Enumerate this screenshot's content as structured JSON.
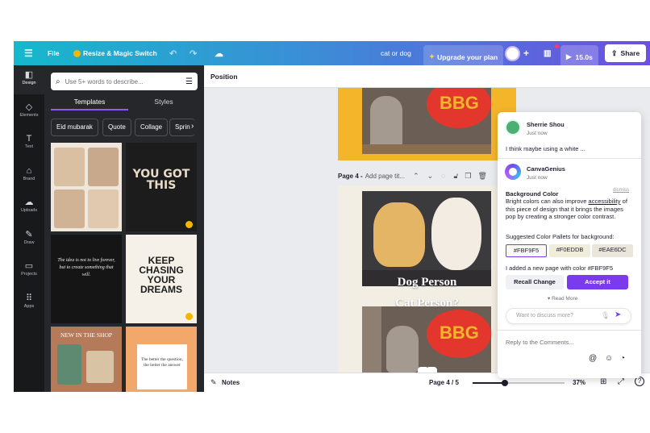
{
  "topbar": {
    "menu_icon": "hamburger-icon",
    "file": "File",
    "resize": "Resize & Magic Switch",
    "design_name": "cat or dog",
    "upgrade": "Upgrade your plan",
    "timer": "15.0s",
    "share": "Share"
  },
  "rail": {
    "items": [
      {
        "label": "Design",
        "icon": "layout-icon"
      },
      {
        "label": "Elements",
        "icon": "shapes-icon"
      },
      {
        "label": "Text",
        "icon": "text-icon"
      },
      {
        "label": "Brand",
        "icon": "brand-icon"
      },
      {
        "label": "Uploads",
        "icon": "cloud-upload-icon"
      },
      {
        "label": "Draw",
        "icon": "pen-icon"
      },
      {
        "label": "Projects",
        "icon": "folder-icon"
      },
      {
        "label": "Apps",
        "icon": "grid-icon"
      }
    ]
  },
  "panel": {
    "search_placeholder": "Use 5+ words to describe...",
    "tabs": [
      "Templates",
      "Styles"
    ],
    "chips": [
      "Eid mubarak",
      "Quote",
      "Collage",
      "Sprin"
    ],
    "templates": {
      "you_got_this": "YOU GOT THIS",
      "quote_text": "The idea is not to live forever, but to create something that will.",
      "keep_chasing": "KEEP CHASING YOUR DREAMS",
      "new_in_shop": "NEW IN THE SHOP",
      "better_question": "The better the question, the better the answer"
    }
  },
  "canvas": {
    "header": "Position",
    "page_label": "Page 4 -",
    "page_title_placeholder": "Add page tit...",
    "overlay_line1": "Dog Person",
    "overlay_line2": "Cat Person?",
    "notes": "Notes",
    "page_counter": "Page 4 / 5",
    "zoom": "37%"
  },
  "comments": {
    "author1": "Sherrie Shou",
    "time1": "Just now",
    "text1": "I think maybe using a white ...",
    "author2": "CanvaGenius",
    "time2": "Just now",
    "dismiss": "dismiss",
    "heading": "Background Color",
    "body_before": "Bright colors can also improve ",
    "body_link": "accessibility",
    "body_after": " of this piece of design that it brings the images pop by creating a stronger color contrast.",
    "suggest_title": "Suggested Color Pallets for background:",
    "swatches": [
      "#FBF9F5",
      "#F0EDDB",
      "#EAE6DC"
    ],
    "added_text": "I added a new page with color #FBF9F5",
    "recall": "Recall Change",
    "accept": "Accept it",
    "read_more": "Read More",
    "discuss_placeholder": "Want to discuss more?",
    "reply_placeholder": "Reply to the Comments..."
  },
  "colors": {
    "accent": "#7c3aed",
    "page_bg": "#f4b52b"
  }
}
